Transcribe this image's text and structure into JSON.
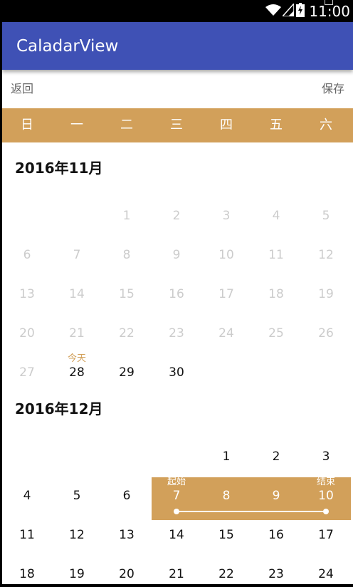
{
  "status_bar": {
    "time": "11:00",
    "icons": [
      "wifi-icon",
      "signal-icon",
      "battery-charging-icon"
    ]
  },
  "toolbar": {
    "title": "CaladarView"
  },
  "actions": {
    "back_label": "返回",
    "save_label": "保存"
  },
  "weekdays": [
    "日",
    "一",
    "二",
    "三",
    "四",
    "五",
    "六"
  ],
  "colors": {
    "primary": "#3f51b5",
    "accent": "#d2a05a",
    "past_text": "#cccccc",
    "text": "#111111"
  },
  "months": [
    {
      "title": "2016年11月",
      "weeks": [
        [
          {
            "d": ""
          },
          {
            "d": ""
          },
          {
            "d": "1",
            "past": true
          },
          {
            "d": "2",
            "past": true
          },
          {
            "d": "3",
            "past": true
          },
          {
            "d": "4",
            "past": true
          },
          {
            "d": "5",
            "past": true
          }
        ],
        [
          {
            "d": "6",
            "past": true
          },
          {
            "d": "7",
            "past": true
          },
          {
            "d": "8",
            "past": true
          },
          {
            "d": "9",
            "past": true
          },
          {
            "d": "10",
            "past": true
          },
          {
            "d": "11",
            "past": true
          },
          {
            "d": "12",
            "past": true
          }
        ],
        [
          {
            "d": "13",
            "past": true
          },
          {
            "d": "14",
            "past": true
          },
          {
            "d": "15",
            "past": true
          },
          {
            "d": "16",
            "past": true
          },
          {
            "d": "17",
            "past": true
          },
          {
            "d": "18",
            "past": true
          },
          {
            "d": "19",
            "past": true
          }
        ],
        [
          {
            "d": "20",
            "past": true
          },
          {
            "d": "21",
            "past": true
          },
          {
            "d": "22",
            "past": true
          },
          {
            "d": "23",
            "past": true
          },
          {
            "d": "24",
            "past": true
          },
          {
            "d": "25",
            "past": true
          },
          {
            "d": "26",
            "past": true
          }
        ],
        [
          {
            "d": "27",
            "past": true
          },
          {
            "d": "28",
            "tag": "今天",
            "today": true
          },
          {
            "d": "29"
          },
          {
            "d": "30"
          },
          {
            "d": ""
          },
          {
            "d": ""
          },
          {
            "d": ""
          }
        ]
      ]
    },
    {
      "title": "2016年12月",
      "weeks": [
        [
          {
            "d": ""
          },
          {
            "d": ""
          },
          {
            "d": ""
          },
          {
            "d": ""
          },
          {
            "d": "1"
          },
          {
            "d": "2"
          },
          {
            "d": "3"
          }
        ],
        [
          {
            "d": "4"
          },
          {
            "d": "5"
          },
          {
            "d": "6"
          },
          {
            "d": "7",
            "tag": "起始",
            "range": true
          },
          {
            "d": "8",
            "range": true
          },
          {
            "d": "9",
            "range": true
          },
          {
            "d": "10",
            "tag": "结束",
            "range": true
          }
        ],
        [
          {
            "d": "11"
          },
          {
            "d": "12"
          },
          {
            "d": "13"
          },
          {
            "d": "14"
          },
          {
            "d": "15"
          },
          {
            "d": "16"
          },
          {
            "d": "17"
          }
        ],
        [
          {
            "d": "18"
          },
          {
            "d": "19"
          },
          {
            "d": "20"
          },
          {
            "d": "21"
          },
          {
            "d": "22"
          },
          {
            "d": "23"
          },
          {
            "d": "24"
          }
        ]
      ]
    }
  ]
}
